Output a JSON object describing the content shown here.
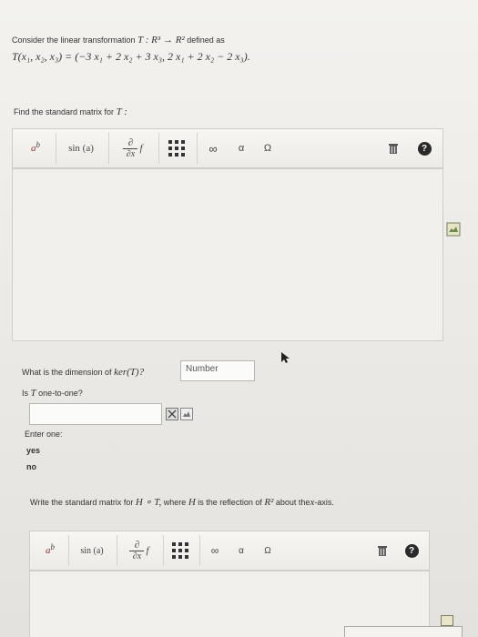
{
  "question": {
    "line1_prefix": "Consider the linear transformation",
    "line1_math": "T : R³ → R²",
    "line1_suffix": "defined as",
    "formula": "T(x₁, x₂, x₃) = (−3 x₁ + 2 x₂ + 3 x₃, 2 x₁ + 2 x₂ − 2 x₃)."
  },
  "part1": {
    "prompt": "Find the standard matrix for",
    "prompt_math": "T :"
  },
  "toolbar": {
    "superscript": "a",
    "superscript_exp": "b",
    "sin": "sin (a)",
    "partial_num": "∂",
    "partial_den": "∂x",
    "partial_f": "f",
    "infinity": "∞",
    "alpha": "α",
    "omega": "Ω",
    "help": "?"
  },
  "part2": {
    "dimension_prompt": "What is the dimension of",
    "dimension_math": "ker(T)?",
    "dimension_placeholder": "Number",
    "one_to_one_prefix": "Is",
    "one_to_one_math": "T",
    "one_to_one_suffix": "one-to-one?"
  },
  "options": {
    "label": "Enter one:",
    "items": [
      "yes",
      "no"
    ]
  },
  "part3": {
    "prefix": "Write the standard matrix for",
    "math1": "H ∘ T,",
    "mid": "where",
    "math2": "H",
    "mid2": "is the reflection of",
    "math3": "R²",
    "mid3": "about the",
    "math4": "x",
    "suffix": "-axis."
  }
}
